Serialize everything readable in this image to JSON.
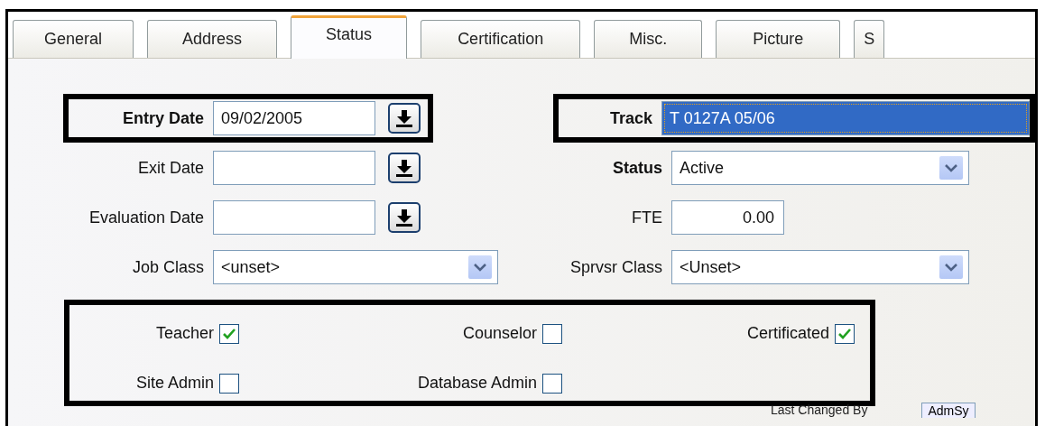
{
  "tabs": [
    {
      "label": "General",
      "selected": false
    },
    {
      "label": "Address",
      "selected": false
    },
    {
      "label": "Status",
      "selected": true
    },
    {
      "label": "Certification",
      "selected": false
    },
    {
      "label": "Misc.",
      "selected": false
    },
    {
      "label": "Picture",
      "selected": false
    },
    {
      "label": "S",
      "selected": false
    }
  ],
  "left_fields": [
    {
      "label": "Entry Date",
      "kind": "date",
      "value": "09/02/2005",
      "bold": true,
      "highlighted": true
    },
    {
      "label": "Exit Date",
      "kind": "date",
      "bold": false,
      "highlighted": false
    },
    {
      "label": "Evaluation Date",
      "kind": "date",
      "bold": false,
      "highlighted": false
    },
    {
      "label": "Job Class",
      "kind": "select",
      "value": "<unset>",
      "bold": false,
      "highlighted": false
    }
  ],
  "right_fields": [
    {
      "label": "Track",
      "kind": "text",
      "value": "T 0127A 05/06",
      "bold": true,
      "highlighted": true,
      "focused": true
    },
    {
      "label": "Status",
      "kind": "select",
      "value": "Active",
      "bold": true,
      "highlighted": false
    },
    {
      "label": "FTE",
      "kind": "number",
      "value": "0.00",
      "bold": false,
      "highlighted": false
    },
    {
      "label": "Sprvsr Class",
      "kind": "select",
      "value": "<Unset>",
      "bold": false,
      "highlighted": false
    }
  ],
  "role_checkboxes": {
    "highlighted": true,
    "items": [
      {
        "label": "Teacher",
        "checked": true
      },
      {
        "label": "Counselor",
        "checked": false
      },
      {
        "label": "Certificated",
        "checked": true
      },
      {
        "label": "Site Admin",
        "checked": false
      },
      {
        "label": "Database Admin",
        "checked": false
      }
    ]
  },
  "last_changed": {
    "label": "Last Changed By",
    "value": "AdmSy"
  }
}
